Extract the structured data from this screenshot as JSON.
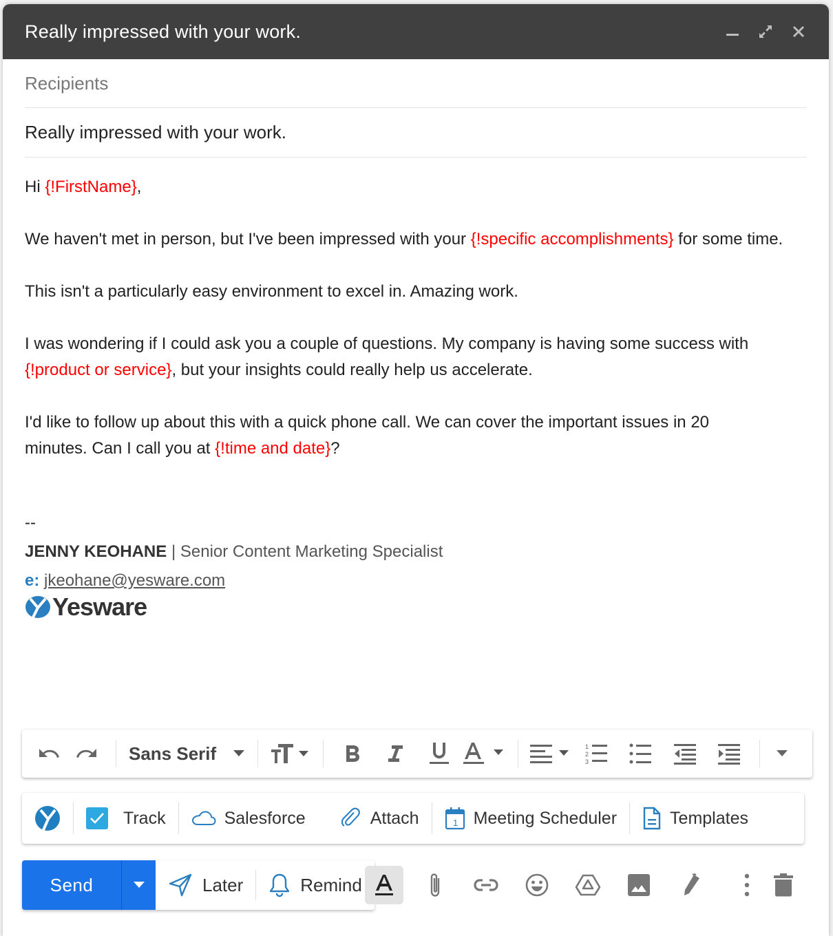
{
  "window": {
    "title": "Really impressed with your work.",
    "controls": [
      "minimize-icon",
      "expand-icon",
      "close-icon"
    ]
  },
  "compose": {
    "recipients_placeholder": "Recipients",
    "subject": "Really impressed with your work."
  },
  "body": {
    "p1": {
      "pre": "Hi ",
      "var": "{!FirstName}",
      "post": ","
    },
    "p2": {
      "pre": "We haven't met in person, but I've been impressed with your ",
      "var": "{!specific accomplishments}",
      "post": " for some time."
    },
    "p3": "This isn't a particularly easy environment to excel in. Amazing work.",
    "p4": {
      "pre": "I was wondering if I could ask you a couple of questions. My company is having some success with ",
      "var": "{!product or service}",
      "post": ", but your insights could really help us accelerate."
    },
    "p5": {
      "pre": "I'd like to follow up about this with a quick phone call. We can cover the important issues in 20 minutes. Can I call you at ",
      "var": "{!time and date}",
      "post": "?"
    }
  },
  "signature": {
    "dash": "--",
    "name": "JENNY KEOHANE",
    "separator": "|",
    "role": "Senior Content Marketing Specialist",
    "email_label": "e:",
    "email": "jkeohane@yesware.com",
    "logo_text": "Yesware"
  },
  "format_toolbar": {
    "font": "Sans Serif",
    "icons": [
      "undo-icon",
      "redo-icon",
      "font-dropdown-icon",
      "text-size-icon",
      "bold-icon",
      "italic-icon",
      "underline-icon",
      "text-color-icon",
      "align-icon",
      "numbered-list-icon",
      "bulleted-list-icon",
      "indent-less-icon",
      "indent-more-icon",
      "more-formatting-icon"
    ]
  },
  "yesware_bar": {
    "track": "Track",
    "track_checked": true,
    "salesforce": "Salesforce",
    "attach": "Attach",
    "meeting": "Meeting Scheduler",
    "templates": "Templates"
  },
  "send_bar": {
    "send": "Send",
    "later": "Later",
    "remind": "Remind",
    "tools": [
      "formatting-options-icon",
      "attach-files-icon",
      "insert-link-icon",
      "insert-emoji-icon",
      "google-drive-icon",
      "insert-photo-icon",
      "signature-icon",
      "more-options-icon",
      "discard-draft-icon"
    ]
  },
  "colors": {
    "titlebar": "#404040",
    "placeholder_red": "#ff0000",
    "send_blue": "#1a73e8",
    "yesware_blue": "#2a7fc0",
    "check_blue": "#2ea8e0"
  }
}
